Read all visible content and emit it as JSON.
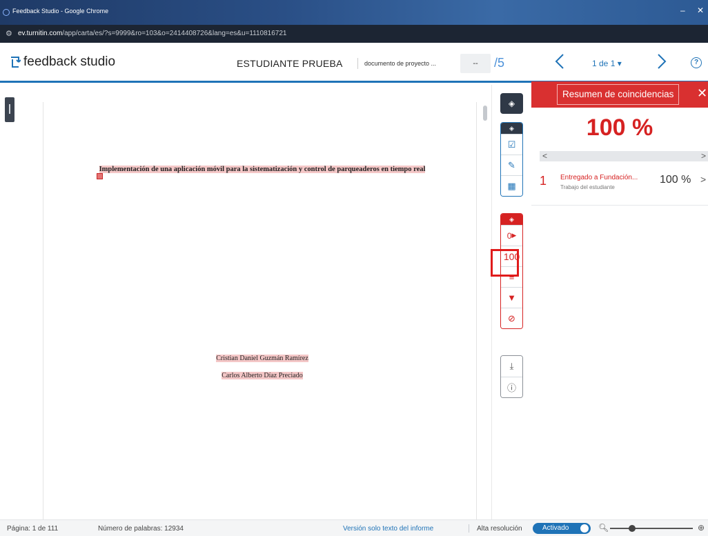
{
  "browser": {
    "window_title": "Feedback Studio - Google Chrome",
    "url_host": "ev.turnitin.com",
    "url_path": "/app/carta/es/?s=9999&ro=103&o=2414408726&lang=es&u=1110816721"
  },
  "header": {
    "logo_text": "feedback studio",
    "student_name": "ESTUDIANTE PRUEBA",
    "document_name": "documento de proyecto ...",
    "grade_value": "--",
    "grade_out_of": "/5",
    "page_selector": "1 de 1 ▾"
  },
  "document": {
    "title": "Implementación de una aplicación móvil para la sistematización y control de parqueaderos en tiempo real",
    "authors": [
      "Cristian Daniel Guzmán Ramírez",
      "Carlos Alberto Díaz Preciado"
    ]
  },
  "toolbar": {
    "flag_count": "0",
    "match_score": "100"
  },
  "panel": {
    "title": "Resumen de coincidencias",
    "total_percent": "100 %",
    "sources": [
      {
        "rank": "1",
        "name": "Entregado a Fundación...",
        "type": "Trabajo del estudiante",
        "percent": "100 %"
      }
    ]
  },
  "status": {
    "page_info": "Página: 1 de 111",
    "word_count": "Número de palabras: 12934",
    "text_only_link": "Versión solo texto del informe",
    "hi_res_label": "Alta resolución",
    "hi_res_toggle": "Activado"
  },
  "colors": {
    "accent": "#1f73b7",
    "similarity": "#d62222"
  }
}
